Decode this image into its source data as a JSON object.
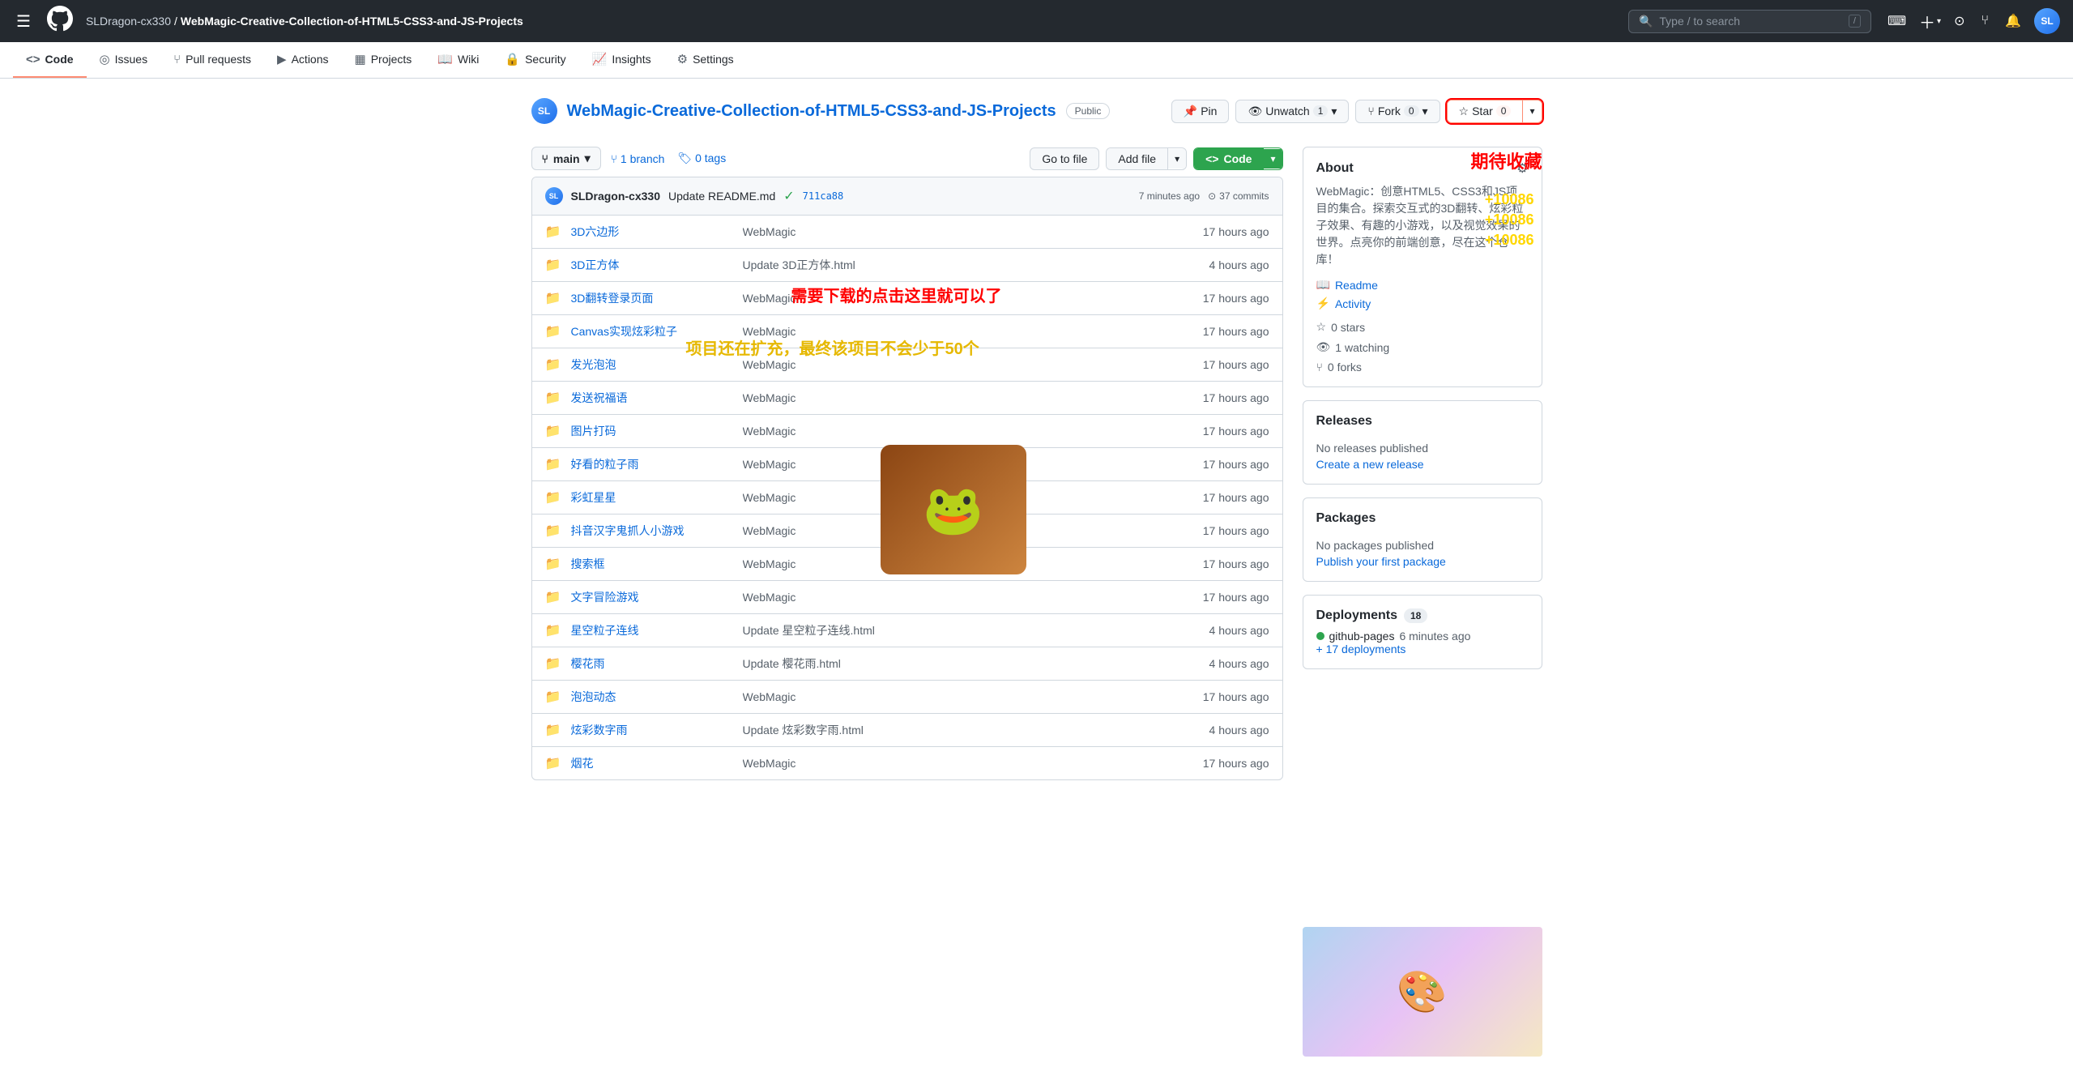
{
  "topNav": {
    "hamburger": "☰",
    "githubLogo": "⬛",
    "breadcrumb": {
      "owner": "SLDragon-cx330",
      "separator": "/",
      "repo": "WebMagic-Creative-Collection-of-HTML5-CSS3-and-JS-Projects"
    },
    "search": {
      "placeholder": "Type / to search"
    },
    "avatarText": "SL"
  },
  "repoNav": {
    "items": [
      {
        "icon": "◈",
        "label": "Code",
        "active": true
      },
      {
        "icon": "◎",
        "label": "Issues"
      },
      {
        "icon": "⑂",
        "label": "Pull requests"
      },
      {
        "icon": "▶",
        "label": "Actions"
      },
      {
        "icon": "▦",
        "label": "Projects"
      },
      {
        "icon": "◉",
        "label": "Wiki"
      },
      {
        "icon": "🔒",
        "label": "Security"
      },
      {
        "icon": "📈",
        "label": "Insights"
      },
      {
        "icon": "⚙",
        "label": "Settings"
      }
    ]
  },
  "repoHeader": {
    "avatarText": "SL",
    "repoName": "WebMagic-Creative-Collection-of-HTML5-CSS3-and-JS-Projects",
    "visibility": "Public",
    "pinBtn": "📌 Pin",
    "watchBtn": "👁 Unwatch",
    "watchCount": "1",
    "forkBtn": "⑂ Fork",
    "forkCount": "0",
    "starBtn": "☆ Star",
    "starCount": "0"
  },
  "branchBar": {
    "branchIcon": "⑂",
    "branchName": "main",
    "branchCount": "1 branch",
    "tagIcon": "🏷",
    "tagCount": "0 tags",
    "goToFile": "Go to file",
    "addFile": "Add file",
    "codeBtn": "◈ Code"
  },
  "commitHeader": {
    "authorAvatar": "SL",
    "authorName": "SLDragon-cx330",
    "commitMsg": "Update README.md",
    "checkIcon": "✓",
    "hash": "711ca88",
    "timeAgo": "7 minutes ago",
    "commitsIcon": "⊙",
    "commitsCount": "37 commits"
  },
  "files": [
    {
      "name": "3D六边形",
      "commit": "WebMagic",
      "time": "17 hours ago"
    },
    {
      "name": "3D正方体",
      "commit": "Update 3D正方体.html",
      "time": "4 hours ago"
    },
    {
      "name": "3D翻转登录页面",
      "commit": "WebMagic",
      "time": "17 hours ago"
    },
    {
      "name": "Canvas实现炫彩粒子",
      "commit": "WebMagic",
      "time": "17 hours ago"
    },
    {
      "name": "发光泡泡",
      "commit": "WebMagic",
      "time": "17 hours ago"
    },
    {
      "name": "发送祝福语",
      "commit": "WebMagic",
      "time": "17 hours ago"
    },
    {
      "name": "图片打码",
      "commit": "WebMagic",
      "time": "17 hours ago"
    },
    {
      "name": "好看的粒子雨",
      "commit": "WebMagic",
      "time": "17 hours ago"
    },
    {
      "name": "彩虹星星",
      "commit": "WebMagic",
      "time": "17 hours ago"
    },
    {
      "name": "抖音汉字鬼抓人小游戏",
      "commit": "WebMagic",
      "time": "17 hours ago"
    },
    {
      "name": "搜索框",
      "commit": "WebMagic",
      "time": "17 hours ago"
    },
    {
      "name": "文字冒险游戏",
      "commit": "WebMagic",
      "time": "17 hours ago"
    },
    {
      "name": "星空粒子连线",
      "commit": "Update 星空粒子连线.html",
      "time": "4 hours ago"
    },
    {
      "name": "樱花雨",
      "commit": "Update 樱花雨.html",
      "time": "4 hours ago"
    },
    {
      "name": "泡泡动态",
      "commit": "WebMagic",
      "time": "17 hours ago"
    },
    {
      "name": "炫彩数字雨",
      "commit": "Update 炫彩数字雨.html",
      "time": "4 hours ago"
    },
    {
      "name": "烟花",
      "commit": "WebMagic",
      "time": "17 hours ago"
    }
  ],
  "about": {
    "title": "About",
    "description": "WebMagic：创意HTML5、CSS3和JS项目的集合。探索交互式的3D翻转、炫彩粒子效果、有趣的小游戏，以及视觉效果的世界。点亮你的前端创意，尽在这个仓库！",
    "readmeLink": "Readme",
    "activityLink": "Activity",
    "starsLabel": "0 stars",
    "watchingLabel": "1 watching",
    "forksLabel": "0 forks"
  },
  "releases": {
    "title": "Releases",
    "noReleases": "No releases published",
    "createLink": "Create a new release"
  },
  "packages": {
    "title": "Packages",
    "noPackages": "No packages published",
    "publishLink": "Publish your first package"
  },
  "deployments": {
    "title": "Deployments",
    "count": "18",
    "latestItem": "github-pages",
    "latestTime": "6 minutes ago",
    "moreLink": "+ 17 deployments"
  },
  "annotations": {
    "downloadText": "需要下载的点击这里就可以了",
    "expandText": "项目还在扩充，最终该项目不会少于50个",
    "waitText": "期待收藏",
    "goldTexts": [
      "+10086",
      "+10086",
      "+10086"
    ]
  }
}
